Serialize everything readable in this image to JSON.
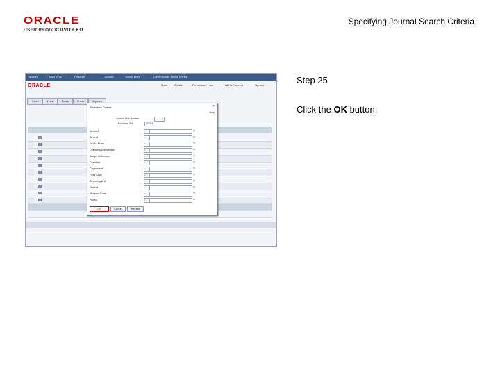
{
  "header": {
    "logo_brand": "ORACLE",
    "logo_subtitle": "USER PRODUCTIVITY KIT",
    "slide_title": "Specifying Journal Search Criteria"
  },
  "step": {
    "label": "Step 25",
    "instruction_prefix": "Click the ",
    "instruction_bold": "OK",
    "instruction_suffix": " button."
  },
  "app": {
    "brand": "ORACLE",
    "nav_items": [
      "Favorites",
      "Main Menu",
      "Financials",
      "Journals",
      "Journal Entry",
      "Create/Update Journal Entries"
    ],
    "header_links": [
      "Home",
      "Worklist",
      "Performance Trace",
      "Add to Favorites",
      "Sign out"
    ],
    "tabs": [
      "Header",
      "Lines",
      "Totals",
      "Errors",
      "Approval"
    ],
    "modal": {
      "title": "Selection Criteria",
      "help": "Help",
      "journal_line_label": "Journal Line Number",
      "journal_line_value": "1",
      "business_unit_label": "Business Unit",
      "business_unit_value": "US001",
      "operator": "=",
      "criteria": [
        "Account",
        "Alt Acct",
        "Fund/Affiliate",
        "Operating Unit Affiliate",
        "Budget Reference",
        "Chartfield",
        "Department",
        "Fund Code",
        "Operating Unit",
        "Product",
        "Program Code",
        "Project"
      ],
      "buttons": {
        "ok": "OK",
        "cancel": "Cancel",
        "refresh": "Refresh"
      }
    }
  }
}
